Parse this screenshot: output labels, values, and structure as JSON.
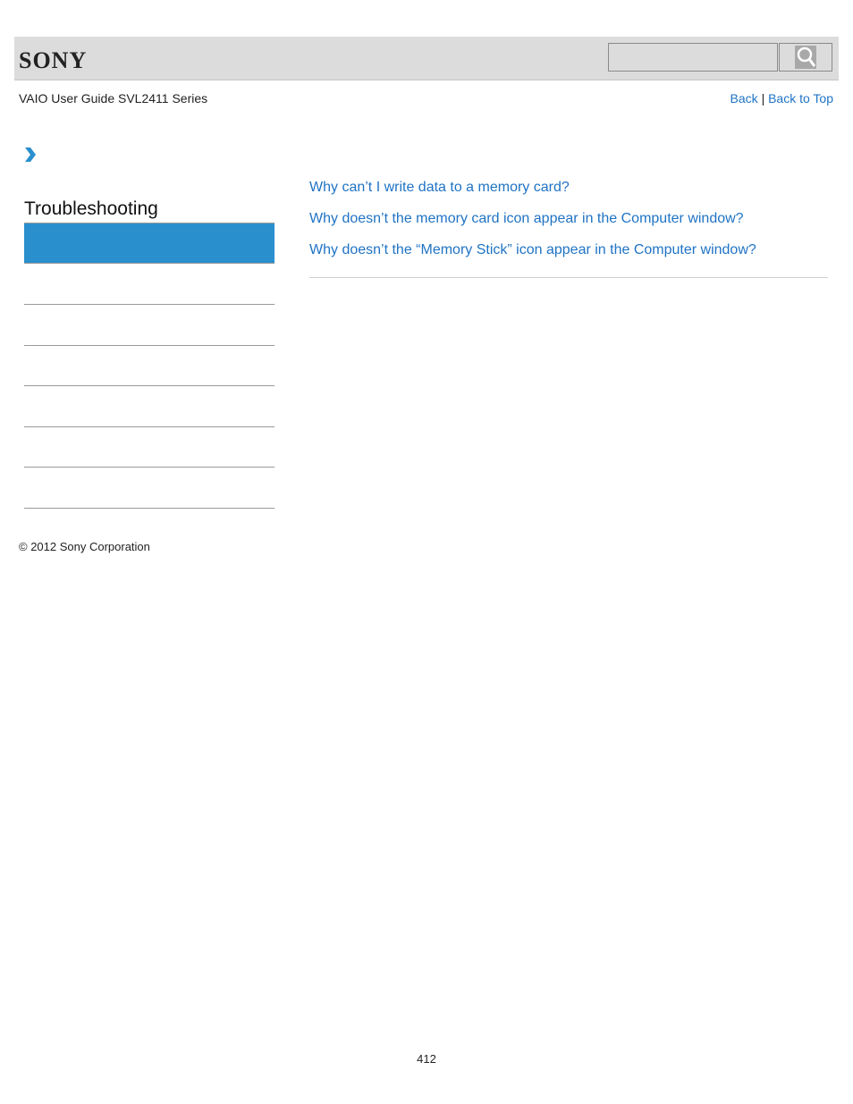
{
  "header": {
    "logo": "SONY",
    "search": {
      "value": "",
      "placeholder": ""
    },
    "search_icon": "magnifier-icon"
  },
  "subheader": {
    "guide_title": "VAIO User Guide SVL2411 Series",
    "back_label": "Back",
    "separator": "|",
    "back_to_top_label": "Back to Top"
  },
  "breadcrumb": {
    "icon": "chevron-right-icon"
  },
  "sidebar": {
    "section_title": "Troubleshooting",
    "accent_color": "#2a8fcd",
    "items": [
      {
        "label": ""
      },
      {
        "label": ""
      },
      {
        "label": ""
      },
      {
        "label": ""
      },
      {
        "label": ""
      },
      {
        "label": ""
      }
    ]
  },
  "main": {
    "links": [
      "Why can’t I write data to a memory card?",
      "Why doesn’t the memory card icon appear in the Computer window?",
      "Why doesn’t the “Memory Stick” icon appear in the Computer window?"
    ],
    "link_color": "#1f73c4"
  },
  "footer": {
    "copyright": "© 2012 Sony Corporation",
    "page_number": "412"
  }
}
